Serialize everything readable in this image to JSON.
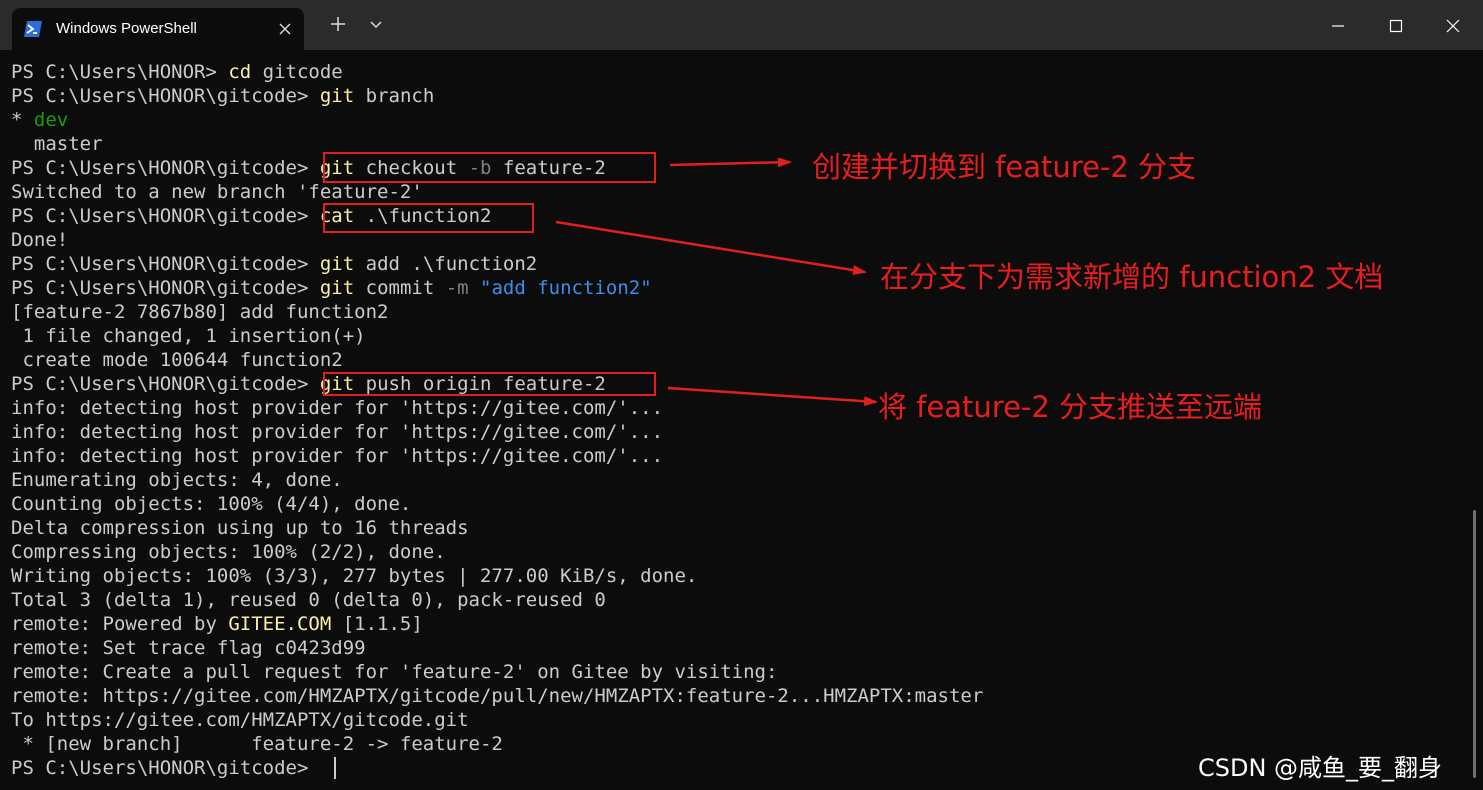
{
  "window": {
    "tab_title": "Windows PowerShell",
    "tab_icon": "powershell-icon",
    "buttons": [
      "close-tab-icon",
      "new-tab-icon",
      "dropdown-icon",
      "minimize-icon",
      "maximize-icon",
      "close-window-icon"
    ]
  },
  "terminal": {
    "lines": [
      [
        {
          "t": "PS C:\\Users\\HONOR> "
        },
        {
          "t": "cd",
          "c": "y"
        },
        {
          "t": " gitcode"
        }
      ],
      [
        {
          "t": "PS C:\\Users\\HONOR\\gitcode> "
        },
        {
          "t": "git",
          "c": "y"
        },
        {
          "t": " branch"
        }
      ],
      [
        {
          "t": "* "
        },
        {
          "t": "dev",
          "c": "g"
        }
      ],
      [
        {
          "t": "  master"
        }
      ],
      [
        {
          "t": "PS C:\\Users\\HONOR\\gitcode> "
        },
        {
          "t": "git",
          "c": "y"
        },
        {
          "t": " checkout "
        },
        {
          "t": "-b",
          "c": "gr"
        },
        {
          "t": " feature-2"
        }
      ],
      [
        {
          "t": "Switched to a new branch 'feature-2'"
        }
      ],
      [
        {
          "t": "PS C:\\Users\\HONOR\\gitcode> "
        },
        {
          "t": "cat",
          "c": "y"
        },
        {
          "t": " .\\function2"
        }
      ],
      [
        {
          "t": "Done!"
        }
      ],
      [
        {
          "t": "PS C:\\Users\\HONOR\\gitcode> "
        },
        {
          "t": "git",
          "c": "y"
        },
        {
          "t": " add .\\function2"
        }
      ],
      [
        {
          "t": "PS C:\\Users\\HONOR\\gitcode> "
        },
        {
          "t": "git",
          "c": "y"
        },
        {
          "t": " commit "
        },
        {
          "t": "-m",
          "c": "gr"
        },
        {
          "t": " "
        },
        {
          "t": "\"add function2\"",
          "c": "b"
        }
      ],
      [
        {
          "t": "[feature-2 7867b80] add function2"
        }
      ],
      [
        {
          "t": " 1 file changed, 1 insertion(+)"
        }
      ],
      [
        {
          "t": " create mode 100644 function2"
        }
      ],
      [
        {
          "t": "PS C:\\Users\\HONOR\\gitcode> "
        },
        {
          "t": "git",
          "c": "y"
        },
        {
          "t": " push origin feature-2"
        }
      ],
      [
        {
          "t": "info: detecting host provider for 'https://gitee.com/'..."
        }
      ],
      [
        {
          "t": "info: detecting host provider for 'https://gitee.com/'..."
        }
      ],
      [
        {
          "t": "info: detecting host provider for 'https://gitee.com/'..."
        }
      ],
      [
        {
          "t": "Enumerating objects: 4, done."
        }
      ],
      [
        {
          "t": "Counting objects: 100% (4/4), done."
        }
      ],
      [
        {
          "t": "Delta compression using up to 16 threads"
        }
      ],
      [
        {
          "t": "Compressing objects: 100% (2/2), done."
        }
      ],
      [
        {
          "t": "Writing objects: 100% (3/3), 277 bytes | 277.00 KiB/s, done."
        }
      ],
      [
        {
          "t": "Total 3 (delta 1), reused 0 (delta 0), pack-reused 0"
        }
      ],
      [
        {
          "t": "remote: Powered by "
        },
        {
          "t": "GITEE.COM",
          "c": "y"
        },
        {
          "t": " [1.1.5]"
        }
      ],
      [
        {
          "t": "remote: Set trace flag c0423d99"
        }
      ],
      [
        {
          "t": "remote: Create a pull request for 'feature-2' on Gitee by visiting:"
        }
      ],
      [
        {
          "t": "remote: https://gitee.com/HMZAPTX/gitcode/pull/new/HMZAPTX:feature-2...HMZAPTX:master"
        }
      ],
      [
        {
          "t": "To https://gitee.com/HMZAPTX/gitcode.git"
        }
      ],
      [
        {
          "t": " * [new branch]      feature-2 -> feature-2"
        }
      ],
      [
        {
          "t": "PS C:\\Users\\HONOR\\gitcode> "
        }
      ]
    ]
  },
  "annotations": {
    "note1": "创建并切换到 feature-2 分支",
    "note2": "在分支下为需求新增的 function2 文档",
    "note3": "将 feature-2 分支推送至远端",
    "color": "#e81e1e"
  },
  "watermark": "CSDN @咸鱼_要_翻身",
  "colors": {
    "background": "#0c0c0c",
    "titlebar": "#2b2b2b",
    "text": "#cccccc",
    "command": "#f9f1a5",
    "branch": "#13a10e",
    "flag": "#808080",
    "string": "#3b8eea"
  }
}
